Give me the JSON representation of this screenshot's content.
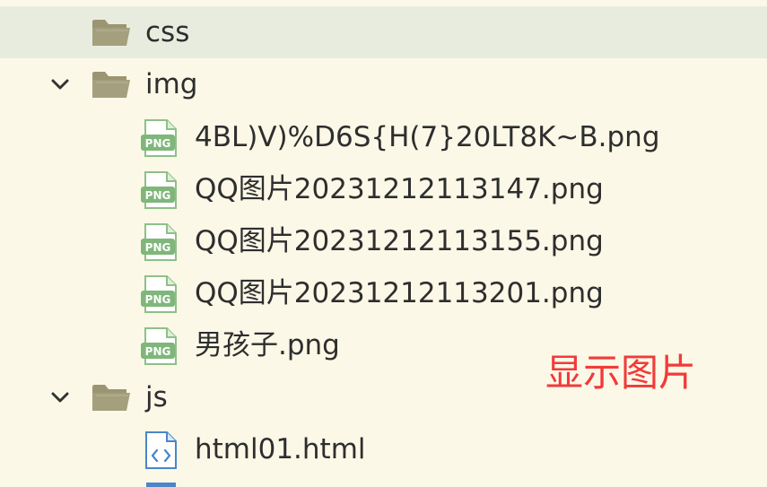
{
  "tree": {
    "items": [
      {
        "label": "css",
        "type": "folder",
        "expanded": false,
        "selected": true
      },
      {
        "label": "img",
        "type": "folder",
        "expanded": true,
        "selected": false
      },
      {
        "label": "4BL)V)%D6S{H(7}20LT8K~B.png",
        "type": "png"
      },
      {
        "label": "QQ图片20231212113147.png",
        "type": "png"
      },
      {
        "label": "QQ图片20231212113155.png",
        "type": "png"
      },
      {
        "label": "QQ图片20231212113201.png",
        "type": "png"
      },
      {
        "label": "男孩子.png",
        "type": "png"
      },
      {
        "label": "js",
        "type": "folder",
        "expanded": true,
        "selected": false
      },
      {
        "label": "html01.html",
        "type": "html"
      }
    ]
  },
  "annotation": {
    "text": "显示图片",
    "color": "#f23a3a"
  },
  "icons": {
    "folder": "folder-icon",
    "png": "png-file-icon",
    "html": "html-file-icon",
    "chevron": "chevron-down-icon"
  },
  "colors": {
    "background": "#fcf8e7",
    "selected_row": "#e8ecdf",
    "folder": "#8f8a6c",
    "png_badge": "#7fb77a",
    "html_icon": "#4a86c8"
  }
}
